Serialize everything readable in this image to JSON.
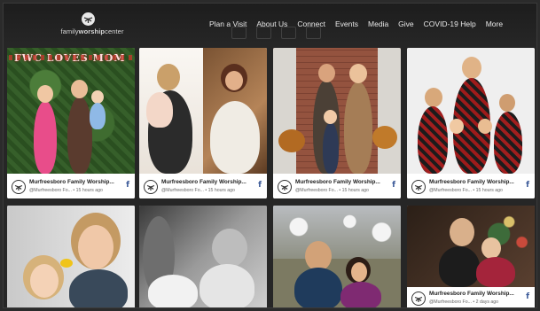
{
  "brand": {
    "name_part1": "family",
    "name_part2": "worship",
    "name_part3": "center"
  },
  "nav": {
    "items": [
      {
        "label": "Plan a Visit"
      },
      {
        "label": "About Us"
      },
      {
        "label": "Connect"
      },
      {
        "label": "Events"
      },
      {
        "label": "Media"
      },
      {
        "label": "Give"
      },
      {
        "label": "COVID-19 Help"
      },
      {
        "label": "More"
      }
    ]
  },
  "cards": [
    {
      "account": "Murfreesboro Family Worship...",
      "meta": "@Murfreesboro Fo... • 15 hours ago",
      "platform": "f",
      "photo_text": "FWC LOVES MOM"
    },
    {
      "account": "Murfreesboro Family Worship...",
      "meta": "@Murfreesboro Fo... • 15 hours ago",
      "platform": "f"
    },
    {
      "account": "Murfreesboro Family Worship...",
      "meta": "@Murfreesboro Fo... • 15 hours ago",
      "platform": "f"
    },
    {
      "account": "Murfreesboro Family Worship...",
      "meta": "@Murfreesboro Fo... • 15 hours ago",
      "platform": "f"
    },
    {
      "account": "",
      "meta": "",
      "platform": ""
    },
    {
      "account": "",
      "meta": "",
      "platform": ""
    },
    {
      "account": "",
      "meta": "",
      "platform": ""
    },
    {
      "account": "Murfreesboro Family Worship...",
      "meta": "@Murfreesboro Fo... • 2 days ago",
      "platform": "f"
    }
  ],
  "colors": {
    "header_bg": "#1d1d1d",
    "page_bg": "#262626",
    "facebook_blue": "#3b5998"
  }
}
